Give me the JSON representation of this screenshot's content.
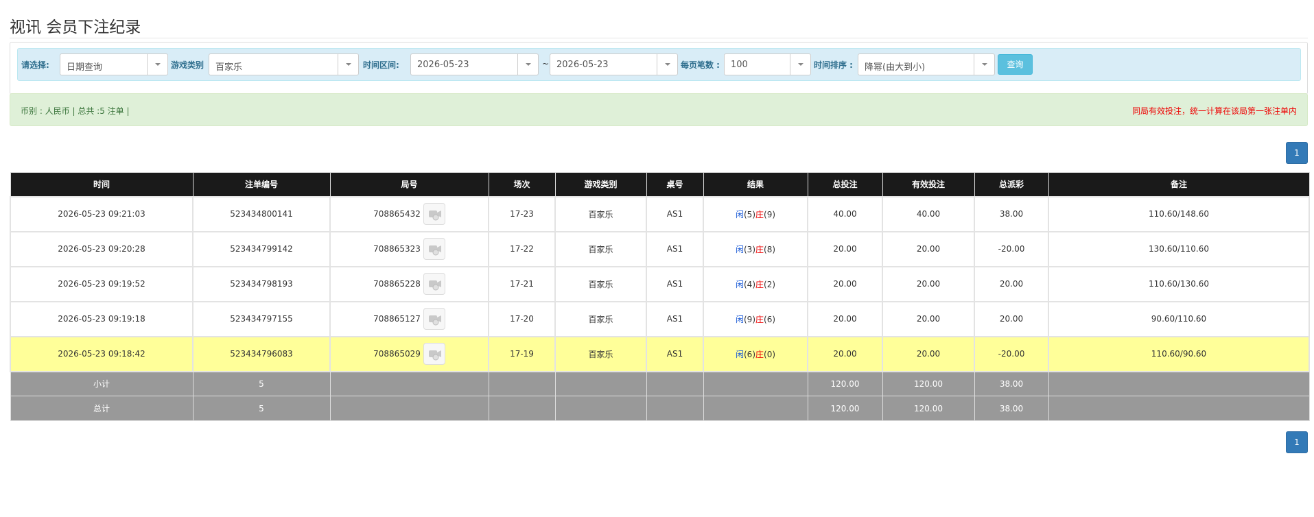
{
  "page": {
    "title": "视讯 会员下注纪录"
  },
  "filters": {
    "select_label": "请选择:",
    "select_value": "日期查询",
    "game_type_label": "游戏类别",
    "game_type_value": "百家乐",
    "time_range_label": "时间区间:",
    "date_from": "2026-05-23",
    "tilde": "~",
    "date_to": "2026-05-23",
    "per_page_label": "每页笔数 :",
    "per_page_value": "100",
    "sort_label": "时间排序 :",
    "sort_value": "降幂(由大到小)",
    "query_button": "查询"
  },
  "summary": {
    "left": "币别 : 人民币 | 总共 :5 注单 |",
    "right": "同局有效投注，统一计算在该局第一张注单内"
  },
  "pagination": {
    "page": "1"
  },
  "table": {
    "headers": [
      "时间",
      "注单编号",
      "局号",
      "场次",
      "游戏类别",
      "桌号",
      "结果",
      "总投注",
      "有效投注",
      "总派彩",
      "备注"
    ],
    "rows": [
      {
        "time": "2026-05-23 09:21:03",
        "bet_id": "523434800141",
        "round": "708865432",
        "session": "17-23",
        "game": "百家乐",
        "table": "AS1",
        "res_player_label": "闲",
        "res_player": "(5)",
        "res_banker_label": "庄",
        "res_banker": "(9)",
        "total_bet": "40.00",
        "valid_bet": "40.00",
        "payout": "38.00",
        "payout_color": "normal",
        "note": "110.60/148.60"
      },
      {
        "time": "2026-05-23 09:20:28",
        "bet_id": "523434799142",
        "round": "708865323",
        "session": "17-22",
        "game": "百家乐",
        "table": "AS1",
        "res_player_label": "闲",
        "res_player": "(3)",
        "res_banker_label": "庄",
        "res_banker": "(8)",
        "total_bet": "20.00",
        "valid_bet": "20.00",
        "payout": "-20.00",
        "payout_color": "red",
        "note": "130.60/110.60"
      },
      {
        "time": "2026-05-23 09:19:52",
        "bet_id": "523434798193",
        "round": "708865228",
        "session": "17-21",
        "game": "百家乐",
        "table": "AS1",
        "res_player_label": "闲",
        "res_player": "(4)",
        "res_banker_label": "庄",
        "res_banker": "(2)",
        "total_bet": "20.00",
        "valid_bet": "20.00",
        "payout": "20.00",
        "payout_color": "normal",
        "note": "110.60/130.60"
      },
      {
        "time": "2026-05-23 09:19:18",
        "bet_id": "523434797155",
        "round": "708865127",
        "session": "17-20",
        "game": "百家乐",
        "table": "AS1",
        "res_player_label": "闲",
        "res_player": "(9)",
        "res_banker_label": "庄",
        "res_banker": "(6)",
        "total_bet": "20.00",
        "valid_bet": "20.00",
        "payout": "20.00",
        "payout_color": "normal",
        "note": "90.60/110.60"
      },
      {
        "time": "2026-05-23 09:18:42",
        "bet_id": "523434796083",
        "round": "708865029",
        "session": "17-19",
        "game": "百家乐",
        "table": "AS1",
        "res_player_label": "闲",
        "res_player": "(6)",
        "res_banker_label": "庄",
        "res_banker": "(0)",
        "total_bet": "20.00",
        "valid_bet": "20.00",
        "payout": "-20.00",
        "payout_color": "red",
        "note": "110.60/90.60",
        "highlight": true
      }
    ],
    "subtotal": {
      "label": "小计",
      "count": "5",
      "total_bet": "120.00",
      "valid_bet": "120.00",
      "payout": "38.00"
    },
    "total": {
      "label": "总计",
      "count": "5",
      "total_bet": "120.00",
      "valid_bet": "120.00",
      "payout": "38.00"
    }
  }
}
